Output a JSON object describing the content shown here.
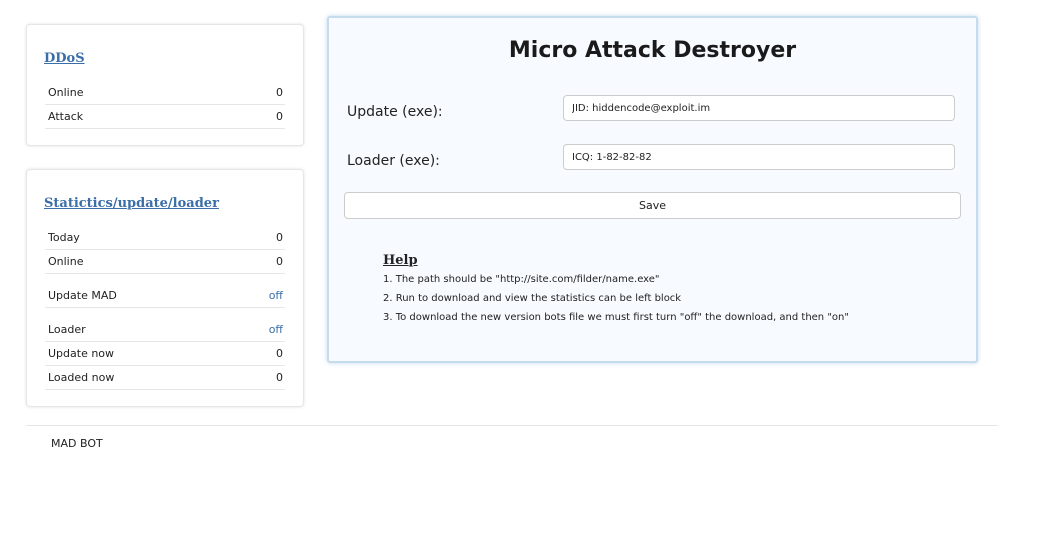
{
  "ddos_panel": {
    "title": "DDoS",
    "rows": [
      {
        "label": "Online",
        "value": "0"
      },
      {
        "label": "Attack",
        "value": "0"
      }
    ]
  },
  "stats_panel": {
    "title": "Statictics/update/loader",
    "rows": [
      {
        "label": "Today",
        "value": "0"
      },
      {
        "label": "Online",
        "value": "0"
      },
      {
        "label": "Update MAD",
        "value": "off"
      },
      {
        "label": "Loader",
        "value": "off"
      },
      {
        "label": "Update now",
        "value": "0"
      },
      {
        "label": "Loaded now",
        "value": "0"
      }
    ]
  },
  "main": {
    "title": "Micro Attack Destroyer",
    "update_label": "Update (exe):",
    "update_value": "JID: hiddencode@exploit.im",
    "loader_label": "Loader (exe):",
    "loader_value": "ICQ: 1-82-82-82",
    "save_label": "Save",
    "help": {
      "title": "Help",
      "lines": [
        "1. The path should be \"http://site.com/filder/name.exe\"",
        "2. Run to download and view the statistics can be left block",
        "3. To download the new version bots file we must first turn \"off\" the download, and then \"on\""
      ]
    }
  },
  "footer": {
    "text": "MAD BOT"
  },
  "colors": {
    "link": "#3a6ea8",
    "main_panel_border": "#c5dced",
    "main_panel_bg": "#f7fbff"
  }
}
